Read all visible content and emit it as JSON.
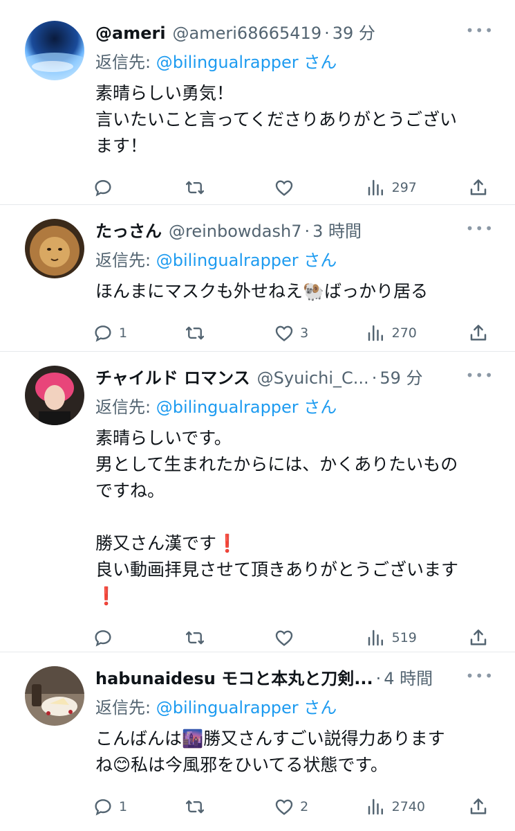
{
  "tweets": [
    {
      "name": "@ameri",
      "handle": "@ameri68665419",
      "time": "39 分",
      "reply_prefix": "返信先: ",
      "reply_to": "@bilingualrapper",
      "reply_suffix": " さん",
      "text": "素晴らしい勇気！\n言いたいこと言ってくださりありがとうござい\nます！",
      "replies": "",
      "retweets": "",
      "likes": "",
      "views": "297",
      "avatar": "earth-avatar"
    },
    {
      "name": "たっさん",
      "handle": "@reinbowdash7",
      "time": "3 時間",
      "reply_prefix": "返信先: ",
      "reply_to": "@bilingualrapper",
      "reply_suffix": " さん",
      "text": "ほんまにマスクも外せねえ🐏ばっかり居る",
      "replies": "1",
      "retweets": "",
      "likes": "3",
      "views": "270",
      "avatar": "lion-avatar"
    },
    {
      "name": "チャイルド ロマンス",
      "handle": "@Syuichi_C...",
      "time": "59 分",
      "reply_prefix": "返信先: ",
      "reply_to": "@bilingualrapper",
      "reply_suffix": " さん",
      "text": "素晴らしいです。\n男として生まれたからには、かくありたいもの\nですね。\n\n勝又さん漢です❗\n良い動画拝見させて頂きありがとうございます\n❗",
      "replies": "",
      "retweets": "",
      "likes": "",
      "views": "519",
      "avatar": "person-avatar"
    },
    {
      "name": "habunaidesu モコと本丸と刀剣...",
      "handle": "",
      "time": "4 時間",
      "reply_prefix": "返信先: ",
      "reply_to": "@bilingualrapper",
      "reply_suffix": " さん",
      "text": "こんばんは🌆勝又さんすごい説得力あります\nね😊私は今風邪をひいてる状態です。",
      "replies": "1",
      "retweets": "",
      "likes": "2",
      "views": "2740",
      "avatar": "cake-avatar"
    }
  ],
  "more_label": "•••",
  "dot": "·"
}
